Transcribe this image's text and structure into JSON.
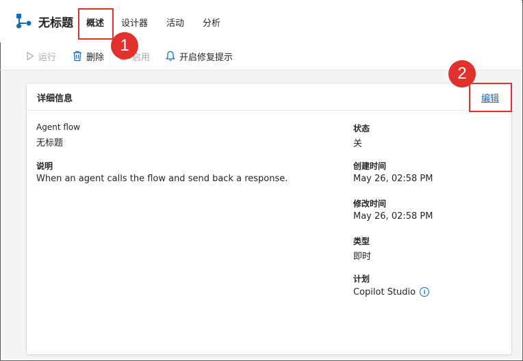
{
  "app": {
    "title": "无标题"
  },
  "tabs": [
    {
      "label": "概述",
      "active": true
    },
    {
      "label": "设计器",
      "active": false
    },
    {
      "label": "活动",
      "active": false
    },
    {
      "label": "分析",
      "active": false
    }
  ],
  "commands": {
    "run": "运行",
    "delete": "删除",
    "enable": "启用",
    "repair_tips": "开启修复提示"
  },
  "details": {
    "title": "详细信息",
    "edit_label": "编辑",
    "left": {
      "flow_type_label": "Agent flow",
      "flow_type_value": "无标题",
      "description_label": "说明",
      "description_value": "When an agent calls the flow and send back a response."
    },
    "right": {
      "status_label": "状态",
      "status_value": "关",
      "created_label": "创建时间",
      "created_value": "May 26, 02:58 PM",
      "modified_label": "修改时间",
      "modified_value": "May 26, 02:58 PM",
      "type_label": "类型",
      "type_value": "即时",
      "plan_label": "计划",
      "plan_value": "Copilot Studio"
    }
  },
  "annotations": {
    "one": "1",
    "two": "2"
  },
  "colors": {
    "accent": "#0f6cbd",
    "callout": "#e0312d",
    "background": "#f5f5f5"
  },
  "icons": {
    "logo": "flow-logo-icon",
    "run": "play-icon",
    "delete": "trash-icon",
    "enable": "power-icon",
    "repair": "bell-icon",
    "plan_info": "info-icon"
  }
}
